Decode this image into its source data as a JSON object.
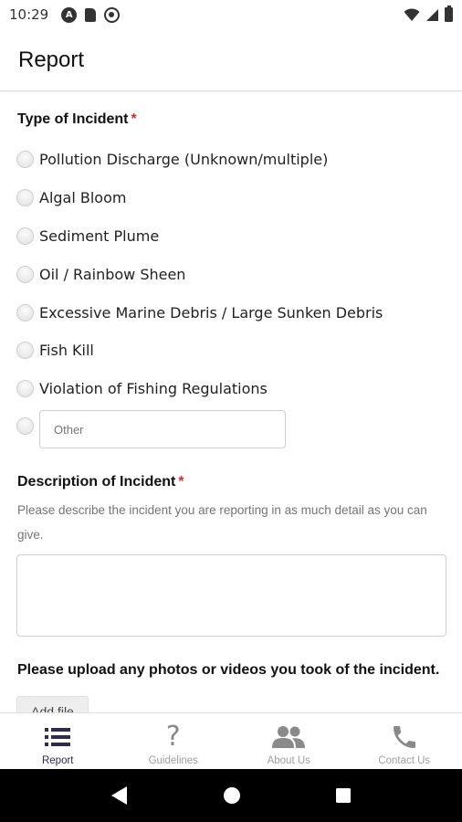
{
  "status_bar": {
    "time": "10:29",
    "left_icons": [
      "a-notification-icon",
      "sd-card-icon",
      "sync-icon"
    ],
    "right_icons": [
      "wifi-icon",
      "signal-icon",
      "battery-icon"
    ]
  },
  "app_bar": {
    "title": "Report"
  },
  "form": {
    "type_label": "Type of Incident",
    "required_mark": "*",
    "options": [
      "Pollution Discharge (Unknown/multiple)",
      "Algal Bloom",
      "Sediment Plume",
      "Oil / Rainbow Sheen",
      "Excessive Marine Debris / Large Sunken Debris",
      "Fish Kill",
      "Violation of Fishing Regulations"
    ],
    "other_placeholder": "Other",
    "description_label": "Description of Incident",
    "description_helper": "Please describe the incident you are reporting in as much detail as you can give.",
    "upload_label": "Please upload any photos or videos you took of the incident.",
    "add_file_label": "Add file"
  },
  "bottom_nav": {
    "items": [
      {
        "label": "Report",
        "icon": "list-icon",
        "active": true
      },
      {
        "label": "Guidelines",
        "icon": "question-icon",
        "active": false
      },
      {
        "label": "About Us",
        "icon": "people-icon",
        "active": false
      },
      {
        "label": "Contact Us",
        "icon": "phone-icon",
        "active": false
      }
    ]
  },
  "colors": {
    "required": "#d32f2f",
    "active_nav": "#2b2b55",
    "inactive_nav": "#9e9e9e"
  }
}
